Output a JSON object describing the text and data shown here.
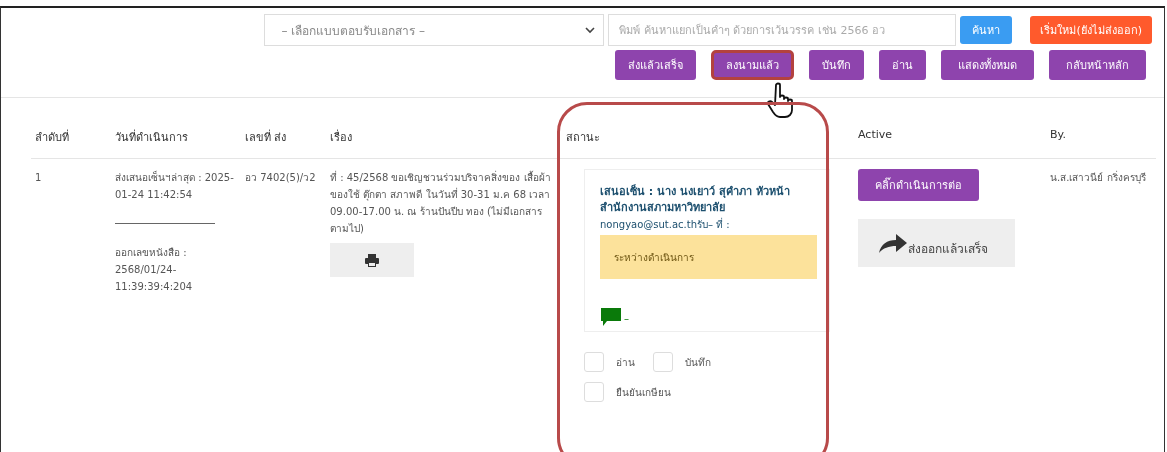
{
  "filter": {
    "select_placeholder": "– เลือกแบบตอบรับเอกสาร –",
    "search_placeholder": "พิมพ์ ค้นหาแยกเป็นคำๆ ด้วยการเว้นวรรค เช่น 2566 อว",
    "search_button": "ค้นหา",
    "reset_button": "เริ่มใหม่(ยังไม่ส่งออก)"
  },
  "nav_buttons": [
    {
      "label": "ส่งแล้วเสร็จ",
      "selected": false
    },
    {
      "label": "ลงนามแล้ว",
      "selected": true
    },
    {
      "label": "บันทึก",
      "selected": false
    },
    {
      "label": "อ่าน",
      "selected": false
    },
    {
      "label": "แสดงทั้งหมด",
      "selected": false
    },
    {
      "label": "กลับหน้าหลัก",
      "selected": false
    }
  ],
  "table": {
    "columns": [
      "ลำดับที่",
      "วันที่ดำเนินการ",
      "เลขที่ ส่ง",
      "เรื่อง",
      "สถานะ",
      "Active",
      "By."
    ],
    "rows": [
      {
        "no": "1",
        "date": "ส่งเสนอเซ็นฯล่าสุด : 2025-01-24 11:42:54",
        "issued": "ออกเลขหนังสือ : 2568/01/24-11:39:39:4:204",
        "doc_no": "อว 7402(5)/ว2",
        "subject": "ที่ : 45/2568  ขอเชิญชวนร่วมบริจาคสิ่งของ เสื้อผ้า ของใช้ ตุ๊กตา สภาพดี ในวันที่ 30-31 ม.ค 68 เวลา 09.00-17.00 น. ณ ร้านปันปีบ ทอง (ไม่มีเอกสารตามไป)",
        "status": {
          "proposer": "เสนอเซ็น : นาง นงเยาว์ สุคำภา หัวหน้าสำนักงานสภามหาวิทยาลัย",
          "email": "nongyao@sut.ac.thรับ– ที่ :",
          "state": "ระหว่างดำเนินการ",
          "comment": "–",
          "checks": [
            {
              "label": "อ่าน",
              "checked": false
            },
            {
              "label": "บันทึก",
              "checked": false
            },
            {
              "label": "ยืนยันเกษียน",
              "checked": false
            }
          ]
        },
        "continue_button": "คลิ๊กดำเนินการต่อ",
        "export_button": "ส่งออกแล้วเสร็จ",
        "by": "น.ส.เสาวนีย์ กริ่งครบุรี"
      }
    ]
  }
}
